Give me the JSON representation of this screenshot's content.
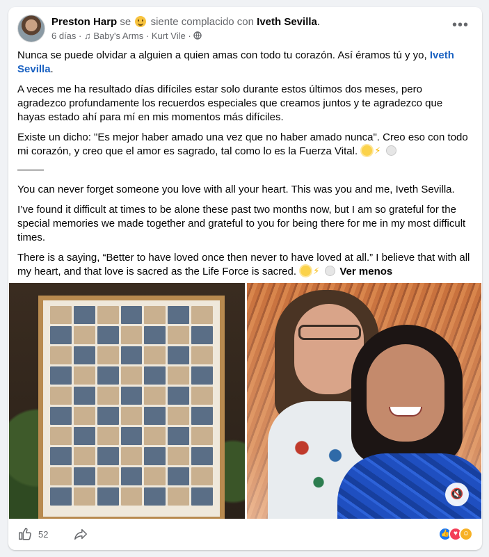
{
  "post": {
    "author": "Preston Harp",
    "feeling_prefix": "se",
    "feeling_text": "siente complacido con",
    "tagged": "Iveth Sevilla",
    "tagged_suffix": ".",
    "time": "6 días",
    "separator": "·",
    "music_title": "Baby's Arms",
    "music_separator": "·",
    "music_artist": "Kurt Vile",
    "privacy_separator": "·",
    "more_label": "•••",
    "paragraphs_es": [
      {
        "text": "Nunca se puede olvidar a alguien a quien amas con todo tu corazón. Así éramos tú y yo, ",
        "link": "Iveth Sevilla",
        "tail": "."
      },
      {
        "text": "A veces me ha resultado días difíciles estar solo durante estos últimos dos meses, pero agradezco profundamente los recuerdos especiales que creamos juntos y te agradezco que hayas estado ahí para mí en mis momentos más difíciles."
      },
      {
        "text": "Existe un dicho: \"Es mejor haber amado una vez que no haber amado nunca\". Creo eso con todo mi corazón, y creo que el amor es sagrado, tal como lo es la Fuerza Vital."
      }
    ],
    "paragraphs_en": [
      {
        "text": "You can never forget someone you love with all your heart. This was you and me, Iveth Sevilla."
      },
      {
        "text": "I’ve found it difficult at times to be alone these past two months now, but I am so grateful for the special memories we made together and grateful to you for being there for me in my most difficult times."
      },
      {
        "text": "There is a saying, “Better to have loved once then never to have loved at all.” I believe that with all my heart, and that love is sacred as the Life Force is sacred."
      }
    ],
    "see_less": "Ver menos",
    "like_count": "52"
  },
  "colors": {
    "link": "#1b62c2",
    "muted": "#65676b",
    "like_blue": "#1877f2",
    "love_red": "#f33e58"
  },
  "icons": {
    "music": "music-note-icon",
    "privacy": "globe-icon",
    "like": "thumbs-up-icon",
    "share": "share-arrow-icon",
    "mute": "speaker-muted-icon"
  }
}
